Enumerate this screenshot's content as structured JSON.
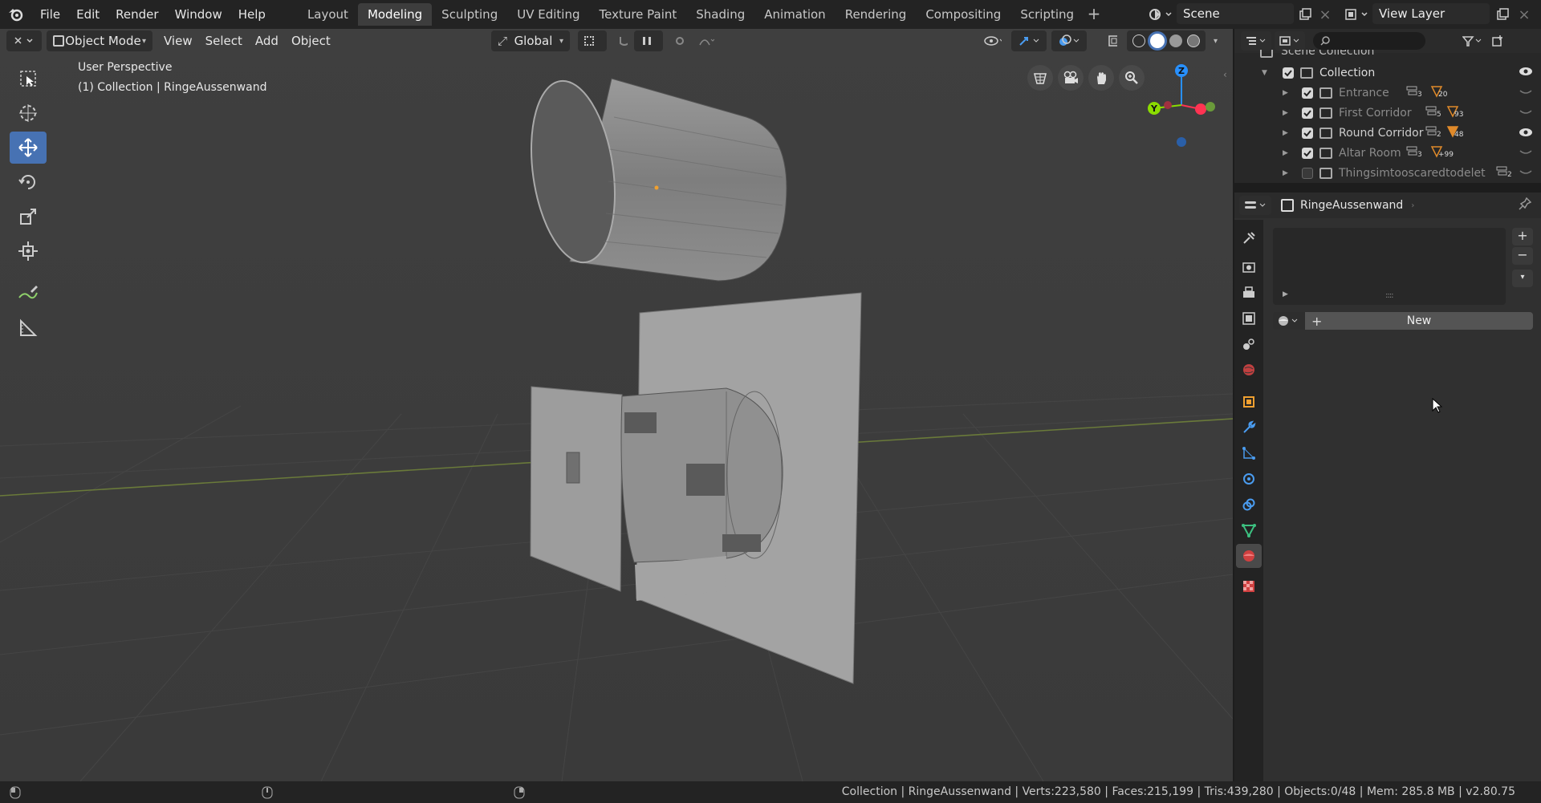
{
  "menubar": {
    "items": [
      "File",
      "Edit",
      "Render",
      "Window",
      "Help"
    ]
  },
  "workspaces": {
    "tabs": [
      "Layout",
      "Modeling",
      "Sculpting",
      "UV Editing",
      "Texture Paint",
      "Shading",
      "Animation",
      "Rendering",
      "Compositing",
      "Scripting"
    ],
    "active": "Modeling"
  },
  "scene": {
    "name": "Scene"
  },
  "view_layer": {
    "name": "View Layer"
  },
  "viewport_header": {
    "mode": "Object Mode",
    "menus": [
      "View",
      "Select",
      "Add",
      "Object"
    ],
    "transform_orientation": "Global"
  },
  "viewport": {
    "perspective": "User Perspective",
    "active_info": "(1) Collection | RingeAussenwand",
    "gizmo_z": "Z",
    "gizmo_y": "Y"
  },
  "outliner": {
    "scene_collection": "Scene Collection",
    "collection": "Collection",
    "rows": [
      {
        "name": "Entrance",
        "count_a": "3",
        "count_b": "20",
        "checked": true,
        "dim": true
      },
      {
        "name": "First Corridor",
        "count_a": "5",
        "count_b": "93",
        "checked": true,
        "dim": true
      },
      {
        "name": "Round Corridor",
        "count_a": "2",
        "count_b": "48",
        "checked": true,
        "dim": false
      },
      {
        "name": "Altar Room",
        "count_a": "3",
        "count_b": "+99",
        "checked": true,
        "dim": true
      },
      {
        "name": "Thingsimtooscaredtodelet",
        "count_a": "2",
        "count_b": "",
        "checked": false,
        "dim": true
      }
    ]
  },
  "properties": {
    "object_name": "RingeAussenwand",
    "new_button": "New"
  },
  "statusbar": {
    "stats": "Collection | RingeAussenwand | Verts:223,580 | Faces:215,199 | Tris:439,280 | Objects:0/48 | Mem: 285.8 MB | v2.80.75"
  },
  "colors": {
    "accent": "#4772b3",
    "viewport_bg": "#3d3d3d",
    "axis_x": "#ff3352",
    "axis_y": "#8bdc00",
    "axis_z": "#2890ff"
  }
}
